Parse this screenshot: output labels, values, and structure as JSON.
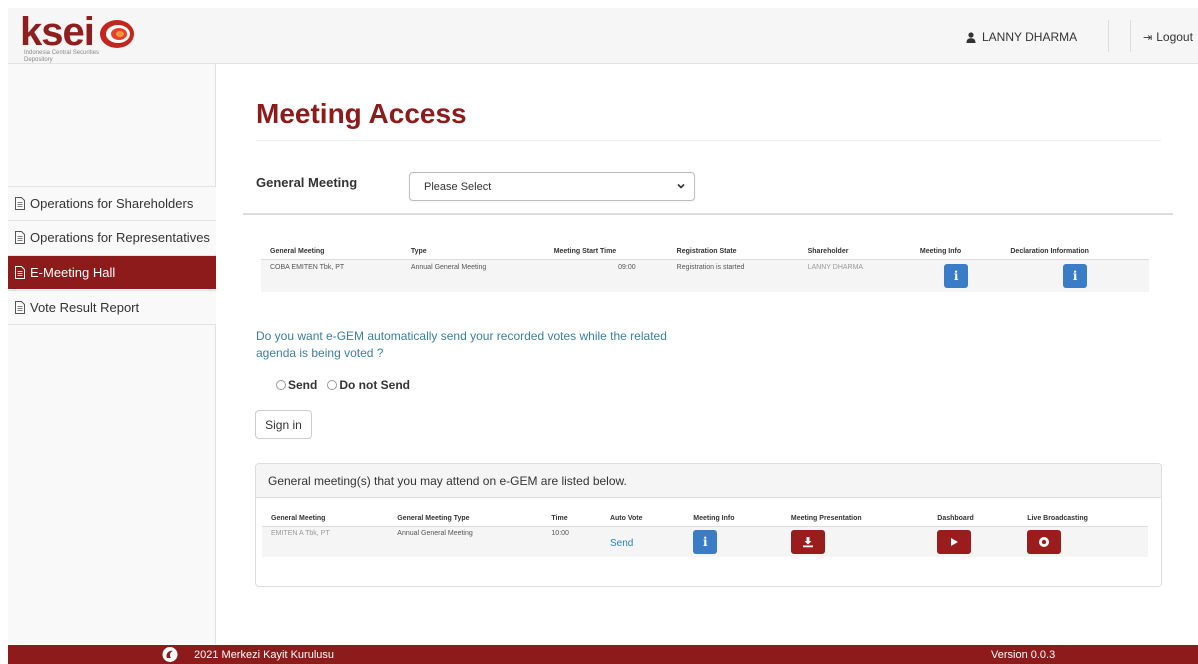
{
  "header": {
    "logo_text": "ksei",
    "logo_tagline": "Indonesia Central Securities Depository",
    "user_name": "LANNY DHARMA",
    "logout_label": "Logout"
  },
  "sidebar": {
    "items": [
      {
        "label": "Operations for Shareholders",
        "active": false
      },
      {
        "label": "Operations for Representatives",
        "active": false
      },
      {
        "label": "E-Meeting Hall",
        "active": true
      },
      {
        "label": "Vote Result Report",
        "active": false
      }
    ]
  },
  "main": {
    "title": "Meeting Access",
    "general_meeting_label": "General Meeting",
    "select_value": "Please Select",
    "registration_table": {
      "headers": [
        "General Meeting",
        "Type",
        "Meeting Start Time",
        "Registration State",
        "Shareholder",
        "Meeting Info",
        "Declaration Information"
      ],
      "row": {
        "general_meeting": "COBA EMITEN Tbk, PT",
        "type": "Annual General Meeting",
        "start_time": "09:00",
        "registration_state": "Registration is started",
        "shareholder": "LANNY DHARMA",
        "info_icon": "i"
      }
    },
    "question": "Do you want e-GEM automatically send your recorded votes while the related agenda is being voted ?",
    "radio_send": "Send",
    "radio_do_not_send": "Do not Send",
    "signin_label": "Sign in",
    "attend_panel": {
      "heading": "General meeting(s) that you may attend on e-GEM are listed below.",
      "headers": [
        "General Meeting",
        "General Meeting Type",
        "Time",
        "Auto Vote",
        "Meeting Info",
        "Meeting Presentation",
        "Dashboard",
        "Live Broadcasting"
      ],
      "row": {
        "general_meeting": "EMITEN A Tbk, PT",
        "type": "Annual General Meeting",
        "time": "10:00",
        "auto_vote": "Send",
        "info_icon": "i"
      }
    }
  },
  "footer": {
    "text": "2021 Merkezi Kayit Kurulusu",
    "version": "Version 0.0.3"
  },
  "colors": {
    "brand": "#8e1b1b",
    "info_button": "#3a7cc6",
    "link": "#2c7fc2"
  }
}
